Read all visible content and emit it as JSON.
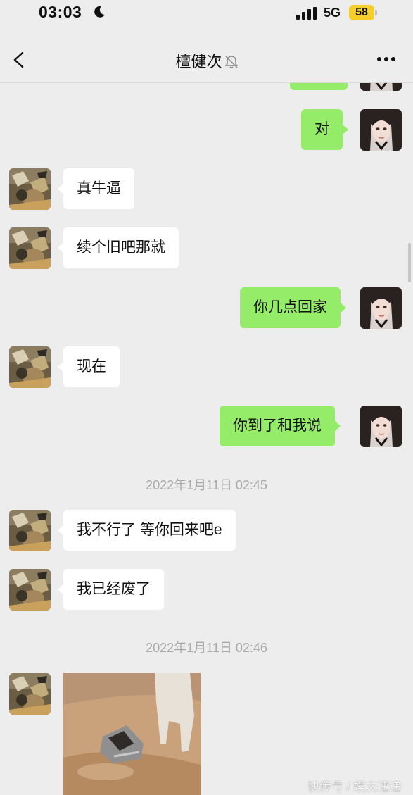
{
  "status": {
    "time": "03:03",
    "network": "5G",
    "battery": "58"
  },
  "nav": {
    "title": "檀健次"
  },
  "messages": {
    "m1": "对",
    "m2": "真牛逼",
    "m3": "续个旧吧那就",
    "m4": "你几点回家",
    "m5": "现在",
    "m6": "你到了和我说",
    "m7": "我不行了 等你回来吧e",
    "m8": "我已经废了"
  },
  "timestamps": {
    "t1": "2022年1月11日 02:45",
    "t2": "2022年1月11日 02:46"
  },
  "watermark": "快传号 / 娱文速递",
  "colors": {
    "background": "#ededed",
    "sent_bubble": "#95ec69",
    "received_bubble": "#ffffff",
    "battery": "#f4cf2b"
  }
}
